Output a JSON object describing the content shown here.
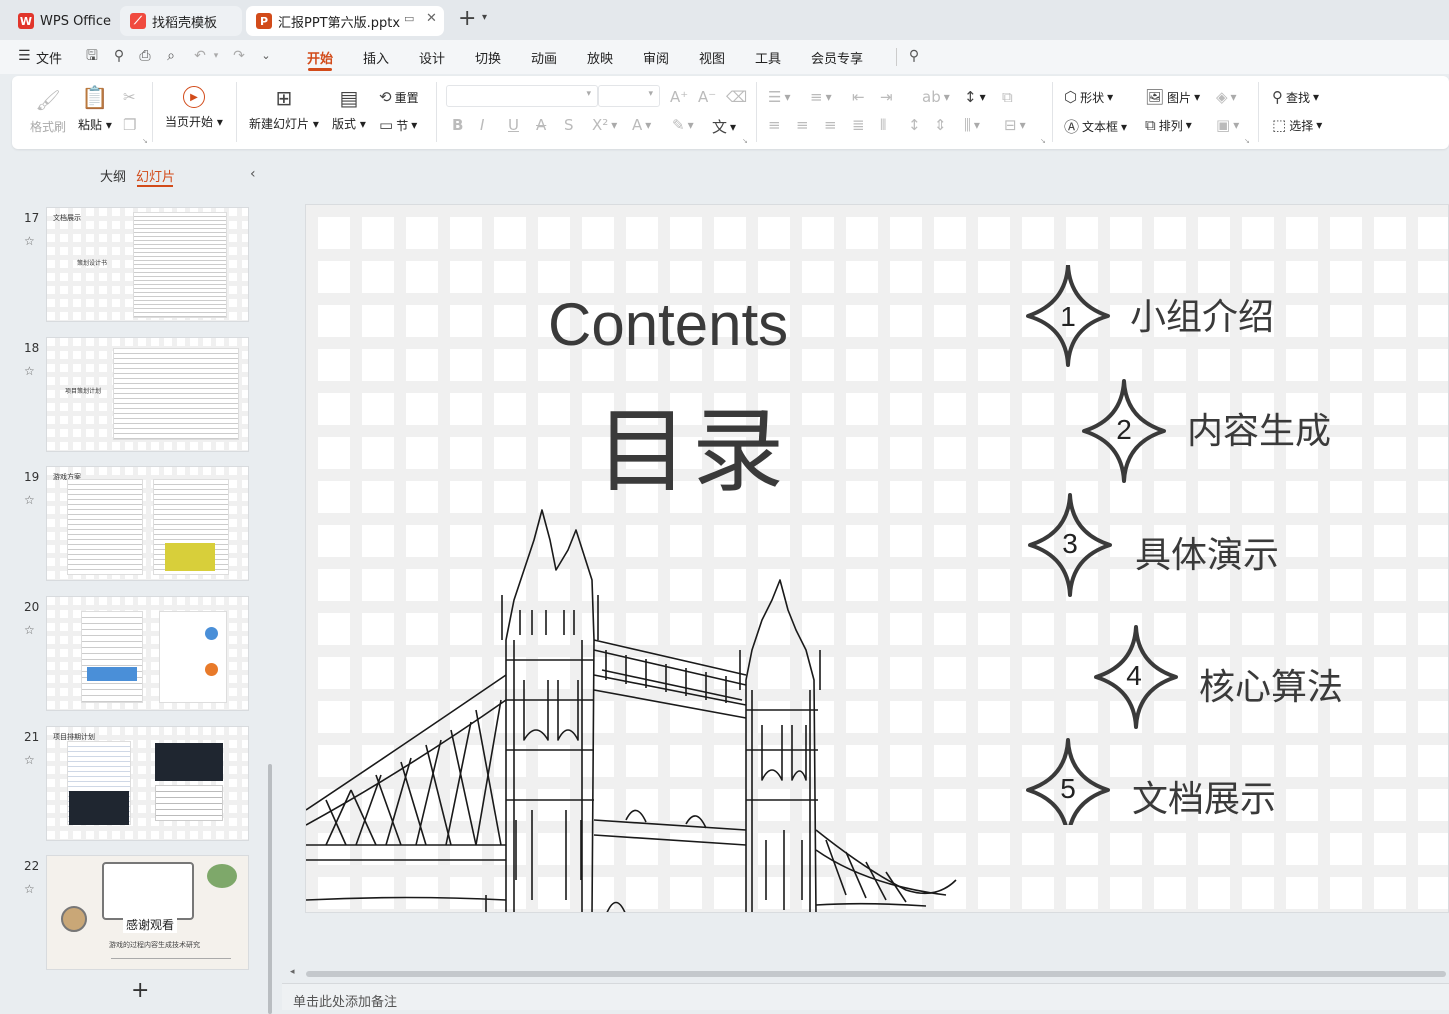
{
  "tabs": [
    {
      "label": "WPS Office",
      "icon": "wps-logo-icon"
    },
    {
      "label": "找稻壳模板",
      "icon": "docer-icon"
    },
    {
      "label": "汇报PPT第六版.pptx",
      "icon": "ppt-file-icon"
    }
  ],
  "menu": {
    "file": "文件",
    "items": [
      "开始",
      "插入",
      "设计",
      "切换",
      "动画",
      "放映",
      "审阅",
      "视图",
      "工具",
      "会员专享"
    ],
    "active": "开始"
  },
  "ribbon": {
    "format_painter": "格式刷",
    "paste": "粘贴",
    "play_current": "当页开始",
    "new_slide": "新建幻灯片",
    "layout": "版式",
    "reset": "重置",
    "section": "节",
    "shape": "形状",
    "picture": "图片",
    "textbox": "文本框",
    "arrange": "排列",
    "find": "查找",
    "select": "选择"
  },
  "leftpane": {
    "outline_tab": "大纲",
    "slides_tab": "幻灯片",
    "thumbs": [
      {
        "num": "17",
        "title": "文档展示",
        "sub": "策划设计书"
      },
      {
        "num": "18",
        "title": "",
        "sub": "项目策划计划"
      },
      {
        "num": "19",
        "title": "游戏方案",
        "sub": ""
      },
      {
        "num": "20",
        "title": "",
        "sub": ""
      },
      {
        "num": "21",
        "title": "项目排期计划",
        "sub": ""
      },
      {
        "num": "22",
        "title": "感谢观看",
        "sub": "游戏的过程内容生成技术研究"
      }
    ],
    "add": "+"
  },
  "slide": {
    "heading_en": "Contents",
    "heading_cn": "目录",
    "items": [
      {
        "num": "1",
        "label": "小组介绍"
      },
      {
        "num": "2",
        "label": "内容生成"
      },
      {
        "num": "3",
        "label": "具体演示"
      },
      {
        "num": "4",
        "label": "核心算法"
      },
      {
        "num": "5",
        "label": "文档展示"
      }
    ]
  },
  "notes_placeholder": "单击此处添加备注",
  "colors": {
    "accent": "#d24b1a",
    "wps_red": "#e1352b",
    "docer_red": "#f04a3f"
  }
}
